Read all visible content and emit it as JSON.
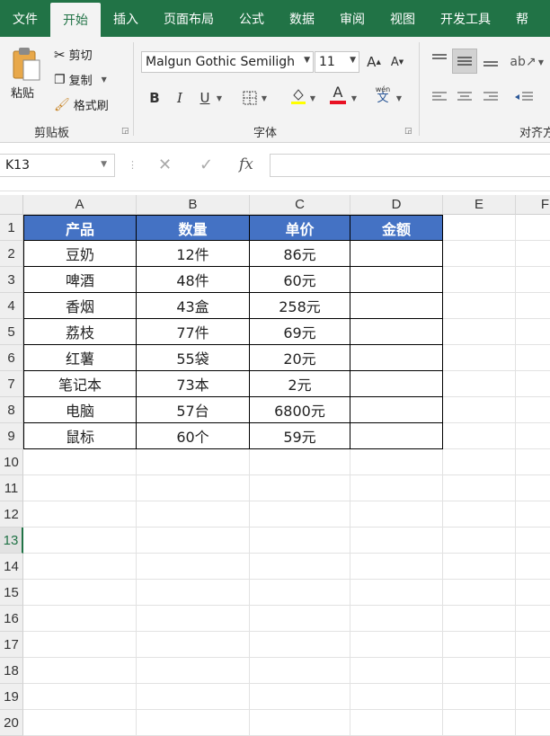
{
  "tabs": [
    {
      "label": "文件",
      "active": false
    },
    {
      "label": "开始",
      "active": true
    },
    {
      "label": "插入",
      "active": false
    },
    {
      "label": "页面布局",
      "active": false
    },
    {
      "label": "公式",
      "active": false
    },
    {
      "label": "数据",
      "active": false
    },
    {
      "label": "审阅",
      "active": false
    },
    {
      "label": "视图",
      "active": false
    },
    {
      "label": "开发工具",
      "active": false
    },
    {
      "label": "帮",
      "active": false
    }
  ],
  "clipboard": {
    "paste_label": "粘贴",
    "cut_label": "剪切",
    "copy_label": "复制",
    "format_painter_label": "格式刷",
    "group_label": "剪贴板"
  },
  "font": {
    "font_name": "Malgun Gothic Semiligh",
    "font_size": "11",
    "bold": "B",
    "italic": "I",
    "underline": "U",
    "font_color_glyph": "A",
    "phonetic_top": "wén",
    "phonetic_bottom": "文",
    "grow_glyph": "A",
    "shrink_glyph": "A",
    "group_label": "字体"
  },
  "alignment": {
    "group_label": "对齐方"
  },
  "colors": {
    "accent": "#217346",
    "header_fill": "#4472c4",
    "font_color_bar": "#e81123"
  },
  "formula_bar": {
    "name_box": "K13",
    "fx_label": "fx",
    "formula": ""
  },
  "columns": [
    "A",
    "B",
    "C",
    "D",
    "E",
    "F"
  ],
  "rows": [
    "1",
    "2",
    "3",
    "4",
    "5",
    "6",
    "7",
    "8",
    "9",
    "10",
    "11",
    "12",
    "13",
    "14",
    "15",
    "16",
    "17",
    "18",
    "19",
    "20"
  ],
  "selected_row": "13",
  "table": {
    "headers": [
      "产品",
      "数量",
      "单价",
      "金额"
    ],
    "data": [
      [
        "豆奶",
        "12件",
        "86元",
        ""
      ],
      [
        "啤酒",
        "48件",
        "60元",
        ""
      ],
      [
        "香烟",
        "43盒",
        "258元",
        ""
      ],
      [
        "荔枝",
        "77件",
        "69元",
        ""
      ],
      [
        "红薯",
        "55袋",
        "20元",
        ""
      ],
      [
        "笔记本",
        "73本",
        "2元",
        ""
      ],
      [
        "电脑",
        "57台",
        "6800元",
        ""
      ],
      [
        "鼠标",
        "60个",
        "59元",
        ""
      ]
    ]
  }
}
